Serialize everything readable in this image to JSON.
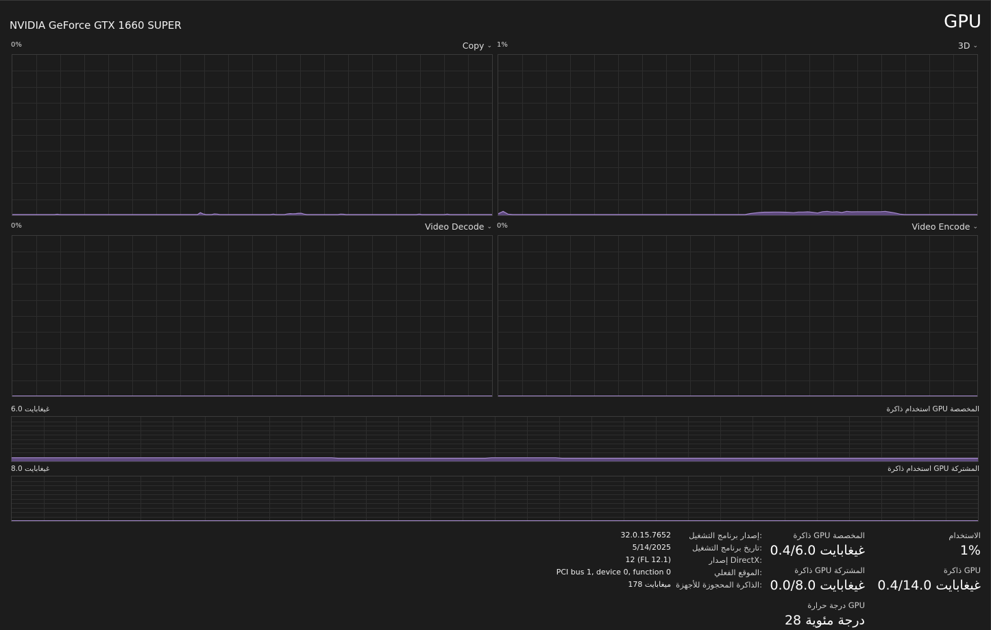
{
  "header": {
    "device_name": "NVIDIA GeForce GTX 1660 SUPER",
    "title": "GPU"
  },
  "engines": [
    {
      "label": "Copy",
      "scale": "0%",
      "series": [
        0,
        0,
        0,
        0,
        0,
        0,
        0,
        0,
        0,
        0,
        0,
        0,
        0,
        0,
        0,
        0,
        0.2,
        0,
        0,
        0,
        0,
        0,
        0,
        0,
        0,
        0,
        0,
        0,
        0,
        0,
        0,
        0,
        0,
        0,
        0,
        0,
        0,
        0,
        0,
        0,
        0,
        0,
        0,
        0,
        0,
        0,
        0,
        0,
        0,
        0,
        0,
        0,
        0,
        0,
        0,
        0,
        0,
        0,
        0,
        0,
        0,
        0,
        0,
        0,
        0,
        0,
        0,
        1.2,
        0.4,
        0,
        0,
        0,
        0.4,
        0.3,
        0,
        0,
        0,
        0,
        0,
        0,
        0,
        0,
        0,
        0,
        0,
        0,
        0,
        0,
        0,
        0,
        0,
        0,
        0,
        0.3,
        0,
        0,
        0,
        0,
        0.4,
        0.6,
        0.5,
        0.6,
        0.8,
        0.8,
        0.3,
        0,
        0,
        0,
        0,
        0,
        0,
        0,
        0,
        0,
        0,
        0,
        0,
        0.3,
        0.2,
        0,
        0,
        0,
        0,
        0,
        0,
        0,
        0,
        0,
        0,
        0,
        0,
        0,
        0,
        0,
        0,
        0,
        0,
        0,
        0,
        0,
        0,
        0,
        0,
        0,
        0,
        0.3,
        0,
        0,
        0,
        0,
        0,
        0,
        0,
        0,
        0,
        0.3,
        0,
        0,
        0,
        0,
        0,
        0,
        0,
        0,
        0,
        0,
        0,
        0,
        0,
        0,
        0,
        0
      ]
    },
    {
      "label": "3D",
      "scale": "1%",
      "series": [
        0.5,
        2.0,
        0.3,
        0,
        0,
        0,
        0,
        0,
        0,
        0,
        0,
        0,
        0,
        0,
        0,
        0,
        0,
        0,
        0,
        0,
        0,
        0,
        0,
        0,
        0,
        0,
        0,
        0,
        0,
        0,
        0,
        0,
        0,
        0,
        0,
        0,
        0,
        0,
        0,
        0,
        0,
        0,
        0,
        0,
        0,
        0,
        0,
        0,
        0,
        0,
        0,
        0,
        0.6,
        1.0,
        1.3,
        1.5,
        1.5,
        1.6,
        1.6,
        1.5,
        1.4,
        1.2,
        1.6,
        1.6,
        1.7,
        1.4,
        1.0,
        1.8,
        2.0,
        1.6,
        1.8,
        1.3,
        2.0,
        1.7,
        1.8,
        1.8,
        1.8,
        1.8,
        1.8,
        1.8,
        2.0,
        1.5,
        1.0,
        0.3,
        0,
        0,
        0,
        0,
        0,
        0,
        0,
        0,
        0,
        0,
        0,
        0,
        0,
        0,
        0,
        0
      ]
    },
    {
      "label": "Video Decode",
      "scale": "0%",
      "series": []
    },
    {
      "label": "Video Encode",
      "scale": "0%",
      "series": []
    }
  ],
  "memory_charts": [
    {
      "label": "استخدام ذاكرة GPU المخصصة",
      "scale": "6.0 غيغابايت",
      "series": [
        0.4,
        0.4,
        0.4,
        0.4,
        0.4,
        0.4,
        0.4,
        0.4,
        0.4,
        0.4,
        0.4,
        0.4,
        0.4,
        0.4,
        0.4,
        0.4,
        0.4,
        0.4,
        0.4,
        0.4,
        0.4,
        0.4,
        0.4,
        0.4,
        0.4,
        0.4,
        0.4,
        0.4,
        0.4,
        0.4,
        0.4,
        0.4,
        0.4,
        0.4,
        0.4,
        0.4,
        0.4,
        0.4,
        0.4,
        0.4,
        0.4,
        0.4,
        0.4,
        0.4,
        0.4,
        0.4,
        0.4,
        0.4,
        0.4,
        0.4,
        0.4,
        0.33,
        0.33,
        0.33,
        0.33,
        0.33,
        0.33,
        0.33,
        0.33,
        0.33,
        0.33,
        0.33,
        0.33,
        0.33,
        0.33,
        0.33,
        0.33,
        0.33,
        0.33,
        0.33,
        0.33,
        0.33,
        0.33,
        0.33,
        0.33,
        0.4,
        0.4,
        0.4,
        0.4,
        0.4,
        0.4,
        0.4,
        0.4,
        0.4,
        0.4,
        0.4,
        0.33,
        0.33,
        0.33,
        0.33,
        0.33,
        0.33,
        0.33,
        0.33,
        0.33,
        0.33,
        0.33,
        0.33,
        0.33,
        0.33,
        0.33,
        0.33,
        0.33,
        0.33,
        0.33,
        0.33,
        0.33,
        0.33,
        0.33,
        0.33,
        0.33,
        0.33,
        0.33,
        0.33,
        0.33,
        0.33,
        0.33,
        0.33,
        0.33,
        0.33,
        0.33,
        0.33,
        0.33,
        0.33,
        0.33,
        0.33,
        0.33,
        0.33,
        0.33,
        0.33,
        0.33,
        0.33,
        0.33,
        0.33,
        0.33,
        0.33,
        0.33,
        0.33,
        0.33,
        0.33,
        0.33,
        0.33,
        0.33,
        0.33,
        0.33,
        0.33,
        0.33,
        0.33,
        0.33,
        0.33,
        0.33,
        0.33
      ]
    },
    {
      "label": "استخدام ذاكرة GPU المشتركة",
      "scale": "8.0 غيغابايت",
      "series": []
    }
  ],
  "stats": {
    "utilization": {
      "label": "الاستخدام",
      "value": "1%"
    },
    "gpu_memory": {
      "label": "ذاكرة GPU",
      "value": "0.4/14.0 غيغابايت"
    },
    "dedicated": {
      "label": "ذاكرة GPU المخصصة",
      "value": "0.4/6.0 غيغابايت"
    },
    "shared": {
      "label": "ذاكرة GPU المشتركة",
      "value": "0.0/8.0 غيغابايت"
    },
    "temperature": {
      "label": "درجة حرارة GPU",
      "value": "28 درجة مئوية"
    }
  },
  "info": [
    {
      "key": "إصدار برنامج التشغيل:",
      "value": "32.0.15.7652"
    },
    {
      "key": "تاريخ برنامج التشغيل:",
      "value": "5/14/2025"
    },
    {
      "key": "إصدار DirectX:",
      "value": "12 (FL 12.1)"
    },
    {
      "key": "الموقع الفعلي:",
      "value": "PCI bus 1, device 0, function 0"
    },
    {
      "key": "الذاكرة المحجوزة للأجهزة:",
      "value": "178 ميغابايت"
    }
  ],
  "colors": {
    "background": "#1c1c1c",
    "grid": "#2d2d2d",
    "border": "#3b3b3b",
    "series_fill": "#5e4a7d",
    "series_line": "#a78bd0"
  },
  "icons": {
    "engine_dropdown": "chevron-down-icon"
  }
}
